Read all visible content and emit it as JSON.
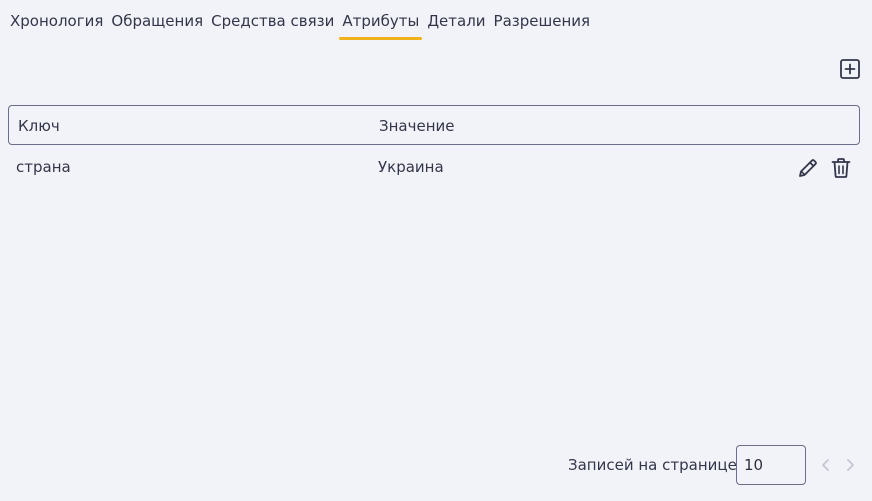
{
  "tabs": [
    {
      "label": "Хронология"
    },
    {
      "label": "Обращения"
    },
    {
      "label": "Средства связи"
    },
    {
      "label": "Атрибуты"
    },
    {
      "label": "Детали"
    },
    {
      "label": "Разрешения"
    }
  ],
  "active_tab": "Атрибуты",
  "table": {
    "headers": {
      "key": "Ключ",
      "value": "Значение"
    },
    "rows": [
      {
        "key": "страна",
        "value": "Украина"
      }
    ]
  },
  "toolbar": {
    "add_icon": "plus-square-icon"
  },
  "row_actions": {
    "edit_icon": "pencil-icon",
    "delete_icon": "trash-icon"
  },
  "pagination": {
    "rows_per_page_label": "Записей на странице:",
    "rows_per_page_value": "10",
    "prev_icon": "chevron-left-icon",
    "next_icon": "chevron-right-icon"
  },
  "colors": {
    "background": "#f2f3f8",
    "accent": "#f0b21b",
    "text": "#33364a",
    "border": "#6b6e8a",
    "disabled": "#c4c6d4"
  }
}
